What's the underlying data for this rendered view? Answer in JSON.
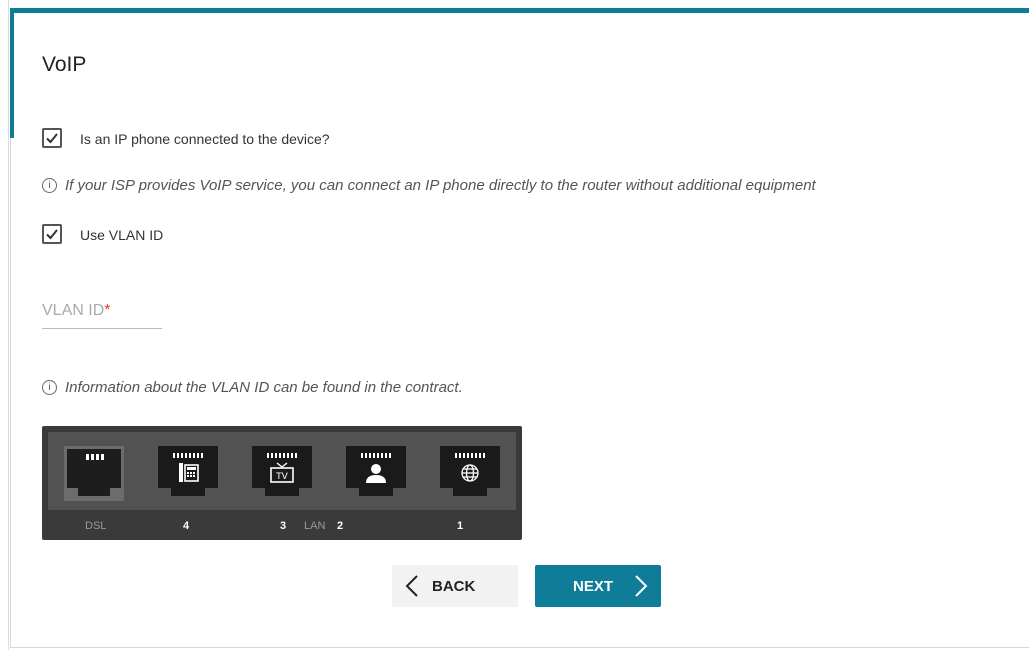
{
  "page": {
    "title": "VoIP"
  },
  "form": {
    "ip_phone_checkbox": {
      "label": "Is an IP phone connected to the device?",
      "checked": true
    },
    "isp_info": "If your ISP provides VoIP service, you can connect an IP phone directly to the router without additional equipment",
    "vlan_checkbox": {
      "label": "Use VLAN ID",
      "checked": true
    },
    "vlan_id_field": {
      "label": "VLAN ID",
      "required_mark": "*",
      "value": ""
    },
    "vlan_info": "Information about the VLAN ID can be found in the contract."
  },
  "ports": {
    "labels": {
      "dsl": "DSL",
      "p4": "4",
      "p3": "3",
      "lan": "LAN",
      "p2": "2",
      "p1": "1"
    },
    "icons": [
      "dsl-port-icon",
      "phone-icon",
      "tv-icon",
      "user-icon",
      "globe-icon"
    ]
  },
  "buttons": {
    "back": "BACK",
    "next": "NEXT"
  },
  "colors": {
    "accent": "#0f7c98",
    "required": "#e23b3b"
  }
}
